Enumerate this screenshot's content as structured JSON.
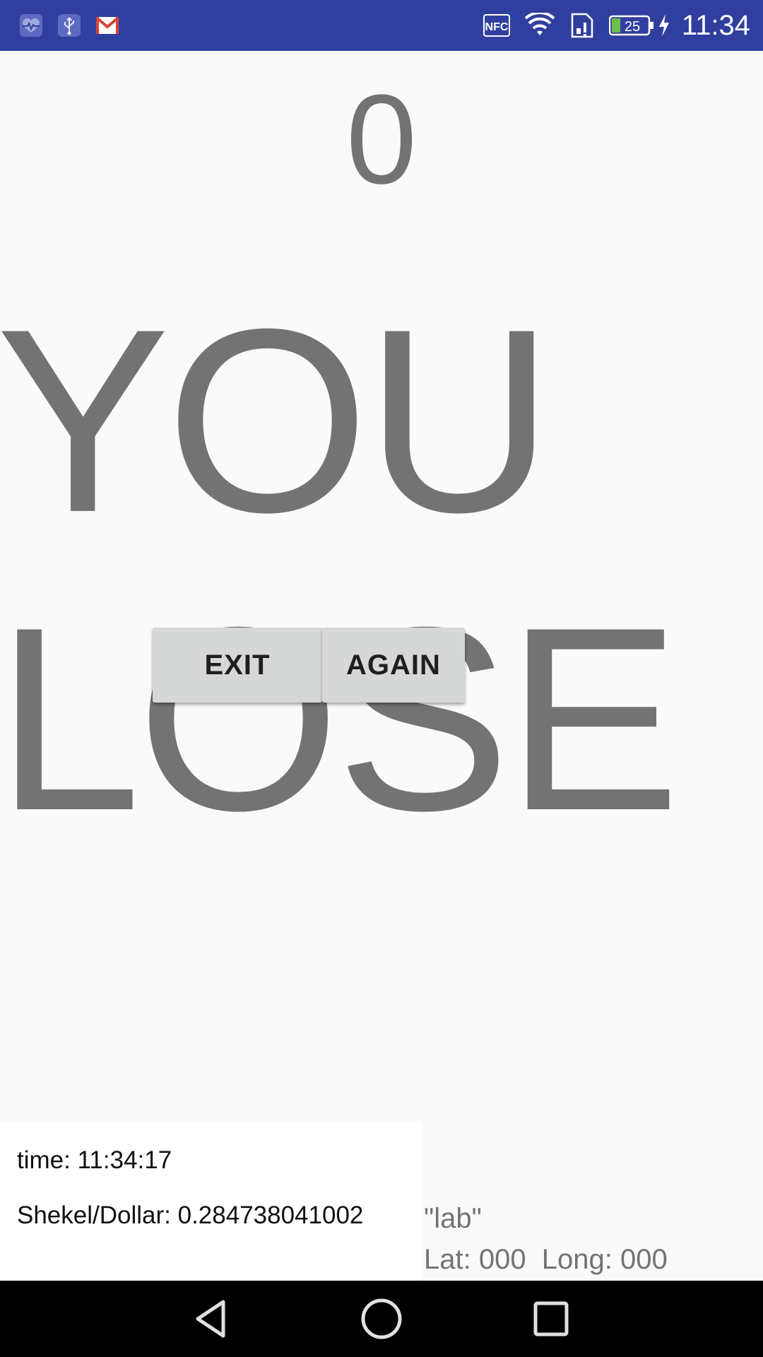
{
  "status_bar": {
    "time": "11:34",
    "battery_level": "25",
    "icons": [
      "health-icon",
      "usb-icon",
      "gmail-icon",
      "nfc-icon",
      "wifi-icon",
      "sim-icon",
      "battery-icon",
      "charging-icon"
    ],
    "background_color": "#303f9f"
  },
  "game": {
    "score": "0",
    "result_text": "YOU\nLOSE",
    "text_color": "#737373"
  },
  "buttons": {
    "exit_label": "EXIT",
    "again_label": "AGAIN"
  },
  "info": {
    "time_text": "time: 11:34:17",
    "rate_text": "Shekel/Dollar: 0.284738041002"
  },
  "location": {
    "name": "\"lab\"",
    "coords": "Lat: 000  Long: 000"
  },
  "nav": {
    "icons": [
      "back-icon",
      "home-icon",
      "recent-apps-icon"
    ]
  }
}
